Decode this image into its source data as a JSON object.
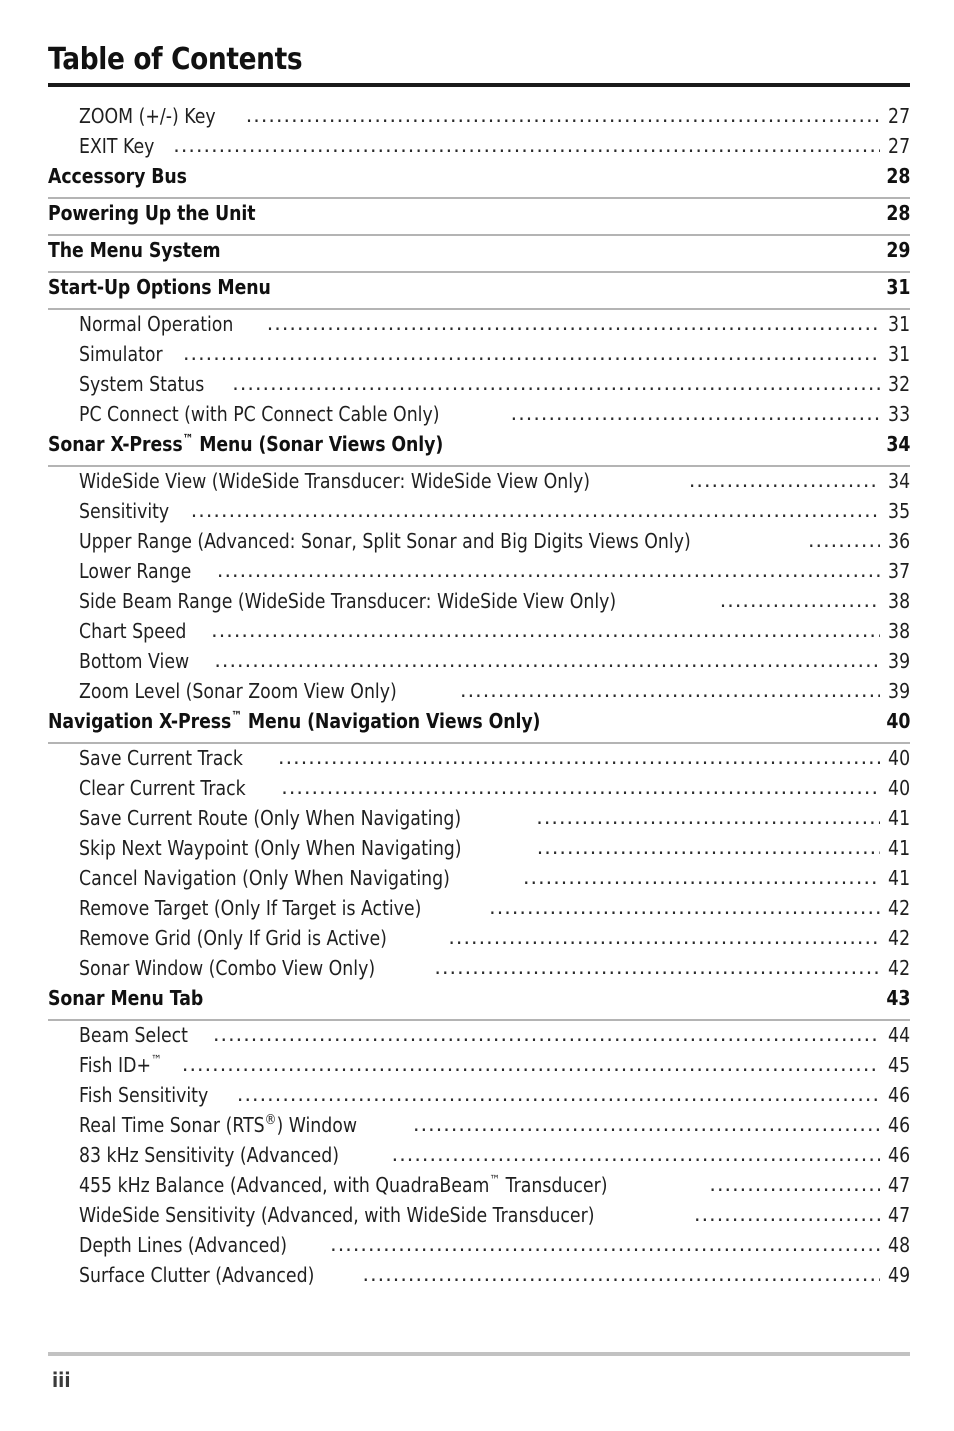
{
  "page": {
    "title": "Table of Contents",
    "folio": "iii"
  },
  "entries": [
    {
      "type": "sub",
      "label": "ZOOM (+/-) Key",
      "page": "27"
    },
    {
      "type": "sub",
      "label": "EXIT Key",
      "page": "27"
    },
    {
      "type": "head",
      "label": "Accessory Bus",
      "page": "28"
    },
    {
      "type": "head",
      "label": "Powering Up the Unit",
      "page": "28"
    },
    {
      "type": "head",
      "label": "The Menu System",
      "page": "29"
    },
    {
      "type": "head",
      "label": "Start-Up Options Menu",
      "page": "31"
    },
    {
      "type": "sub",
      "label": "Normal Operation",
      "page": "31"
    },
    {
      "type": "sub",
      "label": "Simulator",
      "page": "31"
    },
    {
      "type": "sub",
      "label": "System Status",
      "page": "32"
    },
    {
      "type": "sub",
      "label": "PC Connect (with PC Connect Cable Only)",
      "page": "33"
    },
    {
      "type": "head",
      "label": "Sonar X-Press™ Menu (Sonar Views Only)",
      "page": "34",
      "html": "Sonar X-Press<sup class=\"tm\">™</sup> Menu (Sonar Views Only)"
    },
    {
      "type": "sub",
      "label": "WideSide View (WideSide Transducer: WideSide View Only)",
      "page": "34"
    },
    {
      "type": "sub",
      "label": "Sensitivity",
      "page": "35"
    },
    {
      "type": "sub",
      "label": "Upper Range (Advanced: Sonar, Split Sonar and Big Digits Views Only)",
      "page": "36"
    },
    {
      "type": "sub",
      "label": "Lower Range",
      "page": "37"
    },
    {
      "type": "sub",
      "label": "Side Beam Range (WideSide Transducer: WideSide View Only)",
      "page": "38"
    },
    {
      "type": "sub",
      "label": "Chart Speed",
      "page": "38"
    },
    {
      "type": "sub",
      "label": "Bottom View",
      "page": "39"
    },
    {
      "type": "sub",
      "label": "Zoom Level (Sonar Zoom View Only)",
      "page": "39"
    },
    {
      "type": "head",
      "label": "Navigation X-Press™ Menu (Navigation Views Only)",
      "page": "40",
      "html": "Navigation X-Press<sup class=\"tm\">™</sup> Menu (Navigation Views Only)"
    },
    {
      "type": "sub",
      "label": "Save Current Track",
      "page": "40"
    },
    {
      "type": "sub",
      "label": "Clear Current Track",
      "page": "40"
    },
    {
      "type": "sub",
      "label": "Save Current Route (Only When Navigating)",
      "page": "41"
    },
    {
      "type": "sub",
      "label": "Skip Next Waypoint (Only When Navigating)",
      "page": "41"
    },
    {
      "type": "sub",
      "label": "Cancel Navigation (Only When Navigating)",
      "page": "41"
    },
    {
      "type": "sub",
      "label": "Remove Target  (Only If Target is Active)",
      "page": "42"
    },
    {
      "type": "sub",
      "label": "Remove Grid (Only If Grid is Active)",
      "page": "42"
    },
    {
      "type": "sub",
      "label": "Sonar Window (Combo View Only)",
      "page": "42"
    },
    {
      "type": "head",
      "label": "Sonar Menu Tab",
      "page": "43"
    },
    {
      "type": "sub",
      "label": "Beam Select",
      "page": "44"
    },
    {
      "type": "sub",
      "label": "Fish ID+™",
      "page": "45",
      "html": "Fish ID+<sup class=\"tm\">™</sup>"
    },
    {
      "type": "sub",
      "label": "Fish Sensitivity",
      "page": "46"
    },
    {
      "type": "sub",
      "label": "Real Time Sonar (RTS®) Window",
      "page": "46",
      "html": "Real Time Sonar (RTS<sup class=\"reg\">®</sup>) Window"
    },
    {
      "type": "sub",
      "label": "83 kHz Sensitivity (Advanced)",
      "page": "46"
    },
    {
      "type": "sub",
      "label": "455 kHz Balance (Advanced, with QuadraBeam™ Transducer)",
      "page": "47",
      "html": "455 kHz Balance (Advanced, with QuadraBeam<sup class=\"tm\">™</sup> Transducer)"
    },
    {
      "type": "sub",
      "label": "WideSide Sensitivity (Advanced, with WideSide Transducer)",
      "page": "47"
    },
    {
      "type": "sub",
      "label": "Depth Lines (Advanced)",
      "page": "48"
    },
    {
      "type": "sub",
      "label": "Surface Clutter (Advanced)",
      "page": "49"
    }
  ],
  "leader_char": "."
}
